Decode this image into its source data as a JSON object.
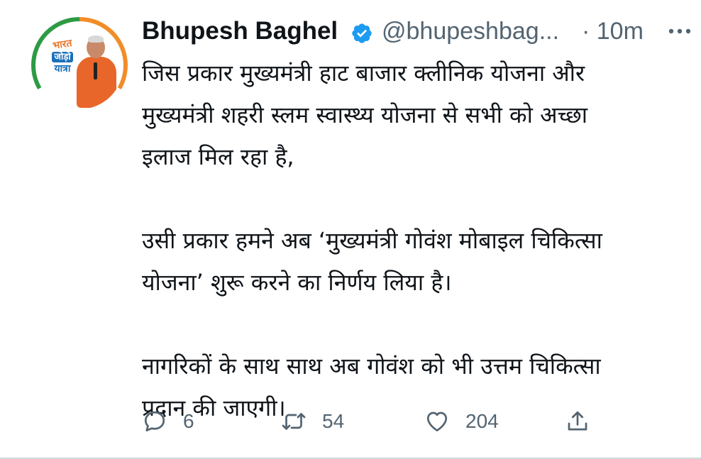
{
  "tweet": {
    "author": {
      "display_name": "Bhupesh Baghel",
      "handle": "@bhupeshbag...",
      "verified": true,
      "avatar_logo_lines": [
        "भारत",
        "जोड़ो",
        "यात्रा"
      ]
    },
    "time": "· 10m",
    "paragraphs": [
      {
        "lines": [
          "जिस प्रकार मुख्यमंत्री हाट बाजार क्लीनिक योजना और",
          "मुख्यमंत्री शहरी स्लम स्वास्थ्य योजना से सभी को अच्छा",
          "इलाज मिल रहा है,"
        ]
      },
      {
        "lines": [
          "उसी प्रकार हमने अब ‘मुख्यमंत्री गोवंश मोबाइल चिकित्सा",
          "योजना’ शुरू करने का निर्णय लिया है।"
        ]
      },
      {
        "lines": [
          "नागरिकों के साथ साथ अब गोवंश को भी उत्तम चिकित्सा",
          "प्रदान की जाएगी।"
        ]
      }
    ],
    "actions": {
      "reply_count": "6",
      "retweet_count": "54",
      "like_count": "204"
    }
  },
  "colors": {
    "text_primary": "#0f1419",
    "text_secondary": "#536471",
    "verified_blue": "#1d9bf0"
  },
  "icons": {
    "verified": "verified-badge-icon",
    "more": "more-options-icon",
    "reply": "reply-icon",
    "retweet": "retweet-icon",
    "like": "heart-icon",
    "share": "share-icon"
  }
}
